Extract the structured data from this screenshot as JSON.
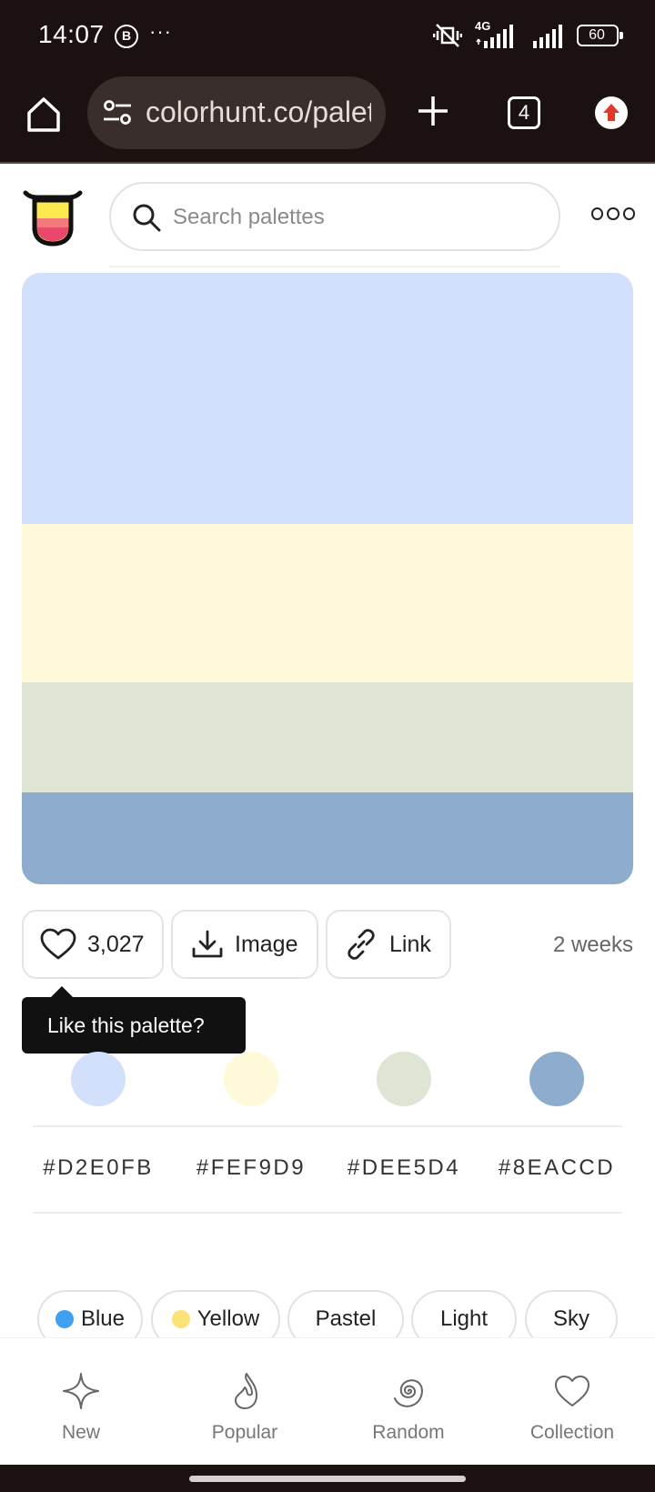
{
  "status_bar": {
    "time": "14:07",
    "notification_icon": "B",
    "more": "···",
    "network": "4G",
    "battery": "60"
  },
  "browser": {
    "url": "colorhunt.co/palette",
    "tab_count": "4"
  },
  "header": {
    "search_placeholder": "Search palettes"
  },
  "palette": {
    "colors": [
      "#D2E0FB",
      "#FEF9D9",
      "#DEE5D4",
      "#8EACCD"
    ],
    "hex_labels": [
      "#D2E0FB",
      "#FEF9D9",
      "#DEE5D4",
      "#8EACCD"
    ]
  },
  "actions": {
    "likes": "3,027",
    "image_label": "Image",
    "link_label": "Link",
    "age": "2 weeks"
  },
  "tooltip": {
    "text": "Like this palette?"
  },
  "tags": [
    {
      "label": "Blue",
      "dot_color": "#3fa0f2"
    },
    {
      "label": "Yellow",
      "dot_color": "#fde276"
    },
    {
      "label": "Pastel"
    },
    {
      "label": "Light"
    },
    {
      "label": "Sky"
    }
  ],
  "bottom_nav": [
    {
      "label": "New",
      "icon": "sparkle-icon"
    },
    {
      "label": "Popular",
      "icon": "flame-icon"
    },
    {
      "label": "Random",
      "icon": "spiral-icon"
    },
    {
      "label": "Collection",
      "icon": "heart-icon"
    }
  ]
}
